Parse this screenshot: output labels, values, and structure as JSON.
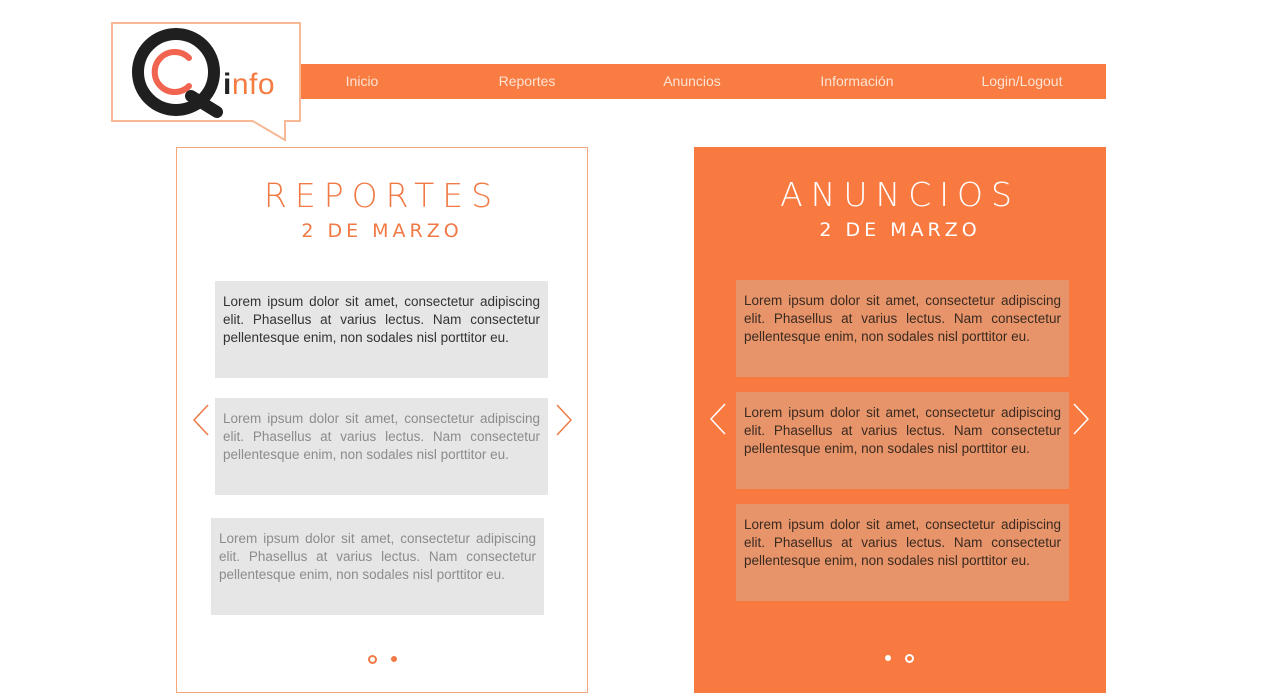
{
  "logo": {
    "text_main": "i",
    "text_accent": "nfo"
  },
  "nav": {
    "items": [
      {
        "label": "Inicio"
      },
      {
        "label": "Reportes"
      },
      {
        "label": "Anuncios"
      },
      {
        "label": "Información"
      },
      {
        "label": "Login/Logout"
      }
    ]
  },
  "reportes": {
    "title": "REPORTES",
    "date": "2 DE MARZO",
    "cards": [
      {
        "text": "Lorem ipsum dolor sit amet, consectetur adipiscing elit. Phasellus at varius lectus. Nam consectetur pellentesque enim, non sodales nisl porttitor eu."
      },
      {
        "text": "Lorem ipsum dolor sit amet, consectetur adipiscing elit. Phasellus at varius lectus. Nam consectetur pellentesque enim, non sodales nisl porttitor eu."
      },
      {
        "text": "Lorem ipsum dolor sit amet, consectetur adipiscing elit. Phasellus at varius lectus. Nam consectetur pellentesque enim, non sodales nisl porttitor eu."
      }
    ],
    "active_page": 2
  },
  "anuncios": {
    "title": "ANUNCIOS",
    "date": "2 DE MARZO",
    "cards": [
      {
        "text": "Lorem ipsum dolor sit amet, consectetur adipiscing elit. Phasellus at varius lectus. Nam consectetur pellentesque enim, non sodales nisl porttitor eu."
      },
      {
        "text": "Lorem ipsum dolor sit amet, consectetur adipiscing elit. Phasellus at varius lectus. Nam consectetur pellentesque enim, non sodales nisl porttitor eu."
      },
      {
        "text": "Lorem ipsum dolor sit amet, consectetur adipiscing elit. Phasellus at varius lectus. Nam consectetur pellentesque enim, non sodales nisl porttitor eu."
      }
    ],
    "active_page": 1
  },
  "colors": {
    "accent": "#f97c43",
    "panel_orange": "#f97a41",
    "card_gray": "#e6e6e6",
    "card_orange": "#e8946a"
  },
  "icons": [
    "logo-cq-icon",
    "chevron-left-icon",
    "chevron-right-icon"
  ]
}
